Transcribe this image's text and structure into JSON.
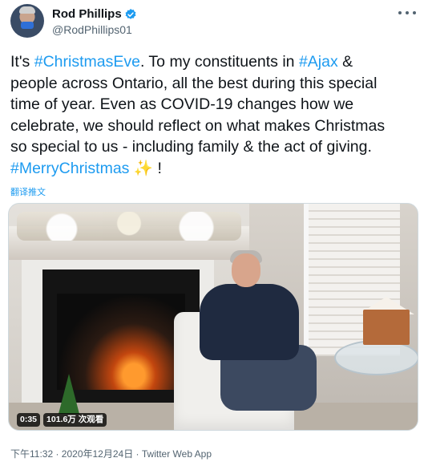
{
  "tweet": {
    "author": {
      "display_name": "Rod Phillips",
      "handle": "@RodPhillips01",
      "verified": true
    },
    "text_lines": [
      [
        {
          "text": "It's ",
          "hashtag": false
        },
        {
          "text": "#ChristmasEve",
          "hashtag": true
        },
        {
          "text": ". To my constituents in ",
          "hashtag": false
        },
        {
          "text": "#Ajax",
          "hashtag": true
        },
        {
          "text": " &",
          "hashtag": false
        }
      ],
      [
        {
          "text": "people across Ontario, all the best during this special",
          "hashtag": false
        }
      ],
      [
        {
          "text": "time of year. Even as COVID-19 changes how we",
          "hashtag": false
        }
      ],
      [
        {
          "text": "celebrate, we should reflect on what makes Christmas",
          "hashtag": false
        }
      ],
      [
        {
          "text": "so special to us - including family & the act of giving.",
          "hashtag": false
        }
      ],
      [
        {
          "text": "#MerryChristmas",
          "hashtag": true
        },
        {
          "text": " ✨ !",
          "hashtag": false
        }
      ]
    ],
    "translate_label": "翻译推文",
    "video": {
      "duration": "0:35",
      "views": "101.6万 次观看"
    },
    "meta": "下午11:32 · 2020年12月24日 · Twitter Web App"
  },
  "colors": {
    "link": "#1d9bf0",
    "text": "#0f1419",
    "muted": "#536471",
    "verified": "#1d9bf0"
  },
  "icons": {
    "verified": "verified-badge-icon",
    "more": "more-options-icon",
    "sparkles": "sparkles-emoji"
  }
}
